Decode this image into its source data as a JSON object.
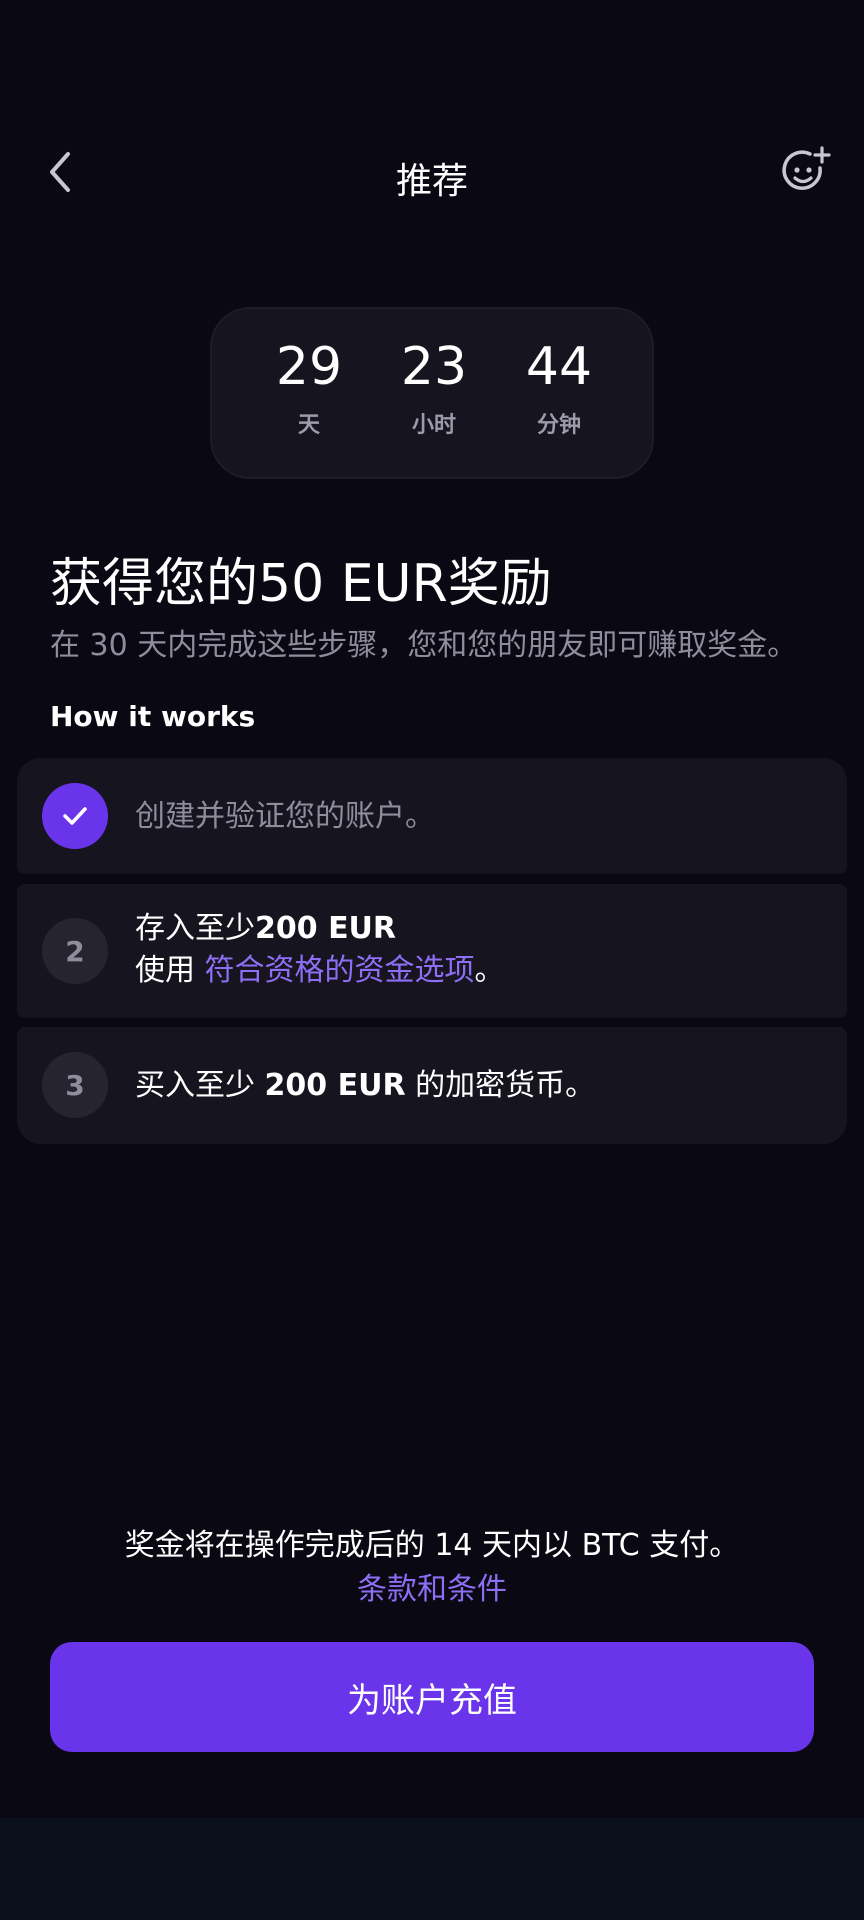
{
  "header": {
    "title": "推荐",
    "back_icon": "chevron-left-icon",
    "invite_icon": "smiley-plus-icon"
  },
  "countdown": {
    "days": {
      "value": "29",
      "label": "天"
    },
    "hours": {
      "value": "23",
      "label": "小时"
    },
    "minutes": {
      "value": "44",
      "label": "分钟"
    }
  },
  "reward": {
    "headline": "获得您的50 EUR奖励",
    "subline": "在 30 天内完成这些步骤，您和您的朋友即可赚取奖金。"
  },
  "how_it_works": {
    "title": "How it works",
    "steps": [
      {
        "status": "completed",
        "badge_icon": "checkmark-icon",
        "text": "创建并验证您的账户。"
      },
      {
        "status": "pending",
        "number": "2",
        "line1_prefix": "存入至少",
        "line1_amount": "200 EUR",
        "line2_prefix": "使用 ",
        "line2_link": "符合资格的资金选项",
        "line2_suffix": "。"
      },
      {
        "status": "pending",
        "number": "3",
        "prefix": "买入至少 ",
        "amount": "200 EUR",
        "suffix": " 的加密货币。"
      }
    ]
  },
  "footer": {
    "note": "奖金将在操作完成后的 14 天内以 BTC 支付。",
    "terms_link": "条款和条件",
    "cta_label": "为账户充值"
  },
  "colors": {
    "background": "#0a0812",
    "card": "#16141f",
    "accent": "#6a35ea",
    "link": "#8c6ff5",
    "muted_text": "#8f8c9c"
  }
}
